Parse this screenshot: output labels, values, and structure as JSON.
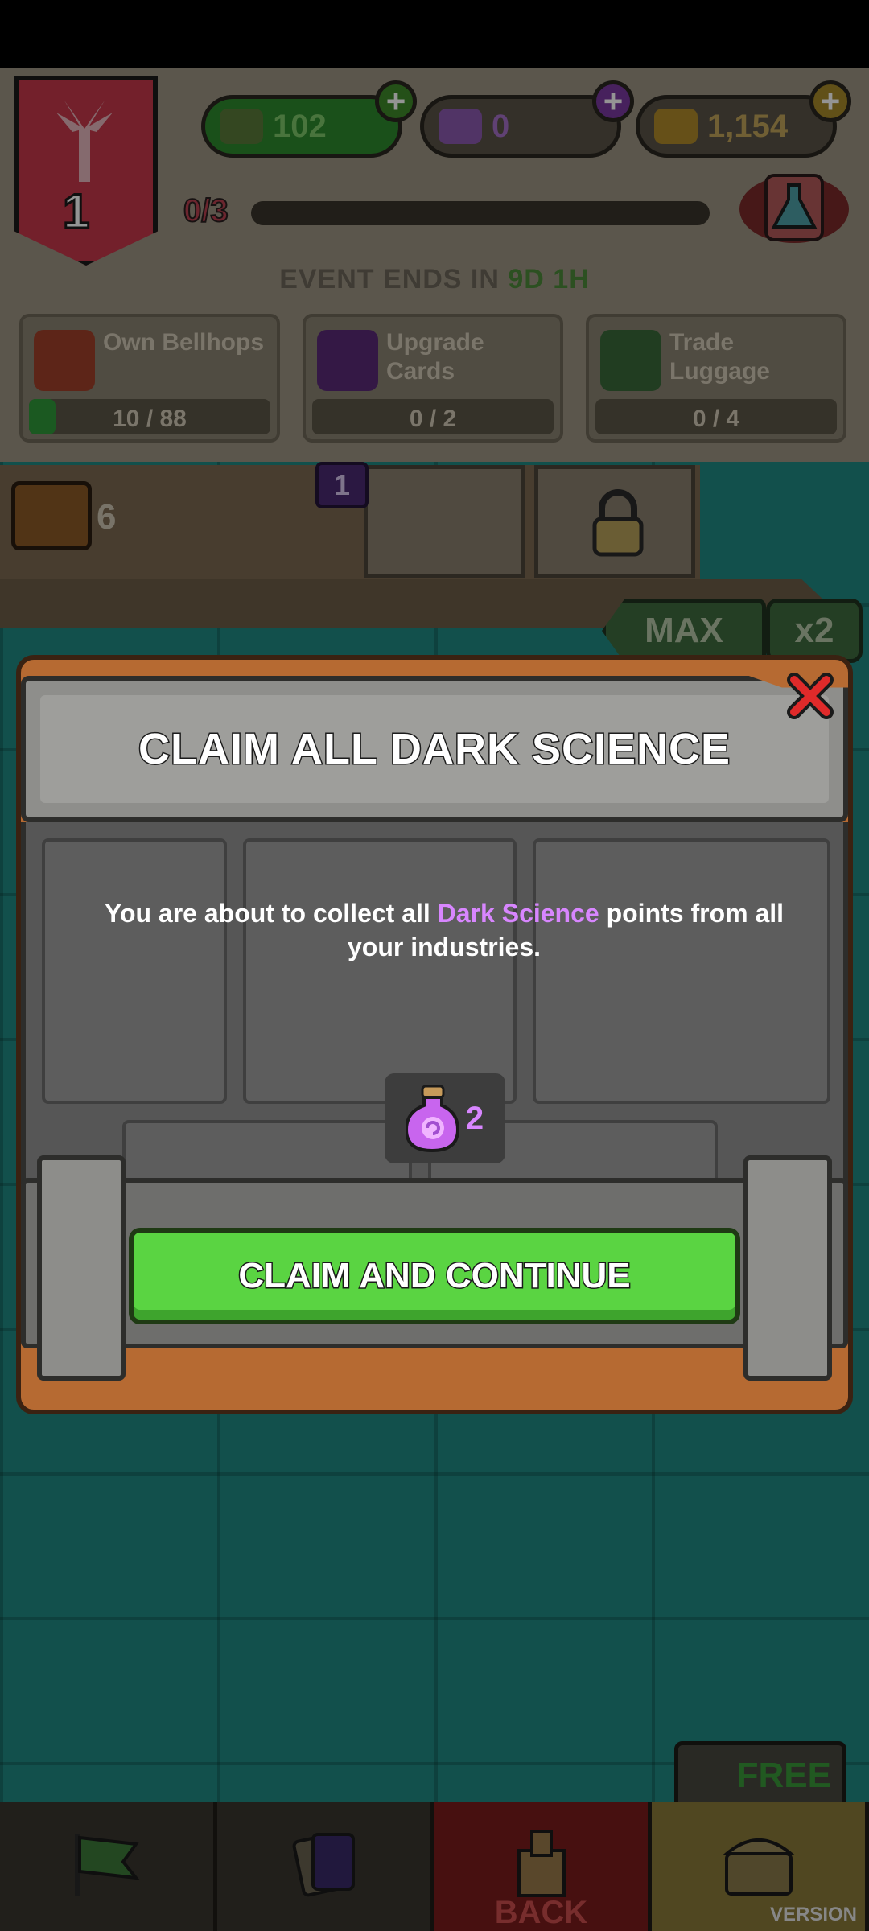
{
  "background": {
    "level": "1",
    "resources": [
      {
        "name": "cash",
        "value": "102",
        "icon": "cash-icon"
      },
      {
        "name": "dark-science",
        "value": "0",
        "icon": "potion-icon"
      },
      {
        "name": "gold",
        "value": "1,154",
        "icon": "gold-bars-icon"
      }
    ],
    "progress_text": "0/3",
    "event_prefix": "EVENT ENDS IN",
    "event_time": "9D 1H",
    "tasks": [
      {
        "label": "Own Bellhops",
        "progress": "10 / 88",
        "fraction": 0.11,
        "icon": "bellhop-hat-icon"
      },
      {
        "label": "Upgrade Cards",
        "progress": "0 / 2",
        "fraction": 0,
        "icon": "up-arrow-icon"
      },
      {
        "label": "Trade Luggage",
        "progress": "0 / 4",
        "fraction": 0,
        "icon": "trade-icon"
      }
    ],
    "luggage_count": "6",
    "slot_badge": "1",
    "max_label": "MAX",
    "x2_label": "x2",
    "free_label": "FREE",
    "nav": {
      "back_label": "BACK",
      "version_label": "VERSION"
    }
  },
  "modal": {
    "title": "CLAIM ALL DARK SCIENCE",
    "description_before": "You are about to collect all ",
    "description_highlight": "Dark Science",
    "description_after": " points from all your industries.",
    "reward": {
      "icon": "dark-science-potion-icon",
      "amount": "2"
    },
    "claim_button": "CLAIM AND CONTINUE"
  },
  "colors": {
    "highlight": "#d886ff",
    "claim_button": "#5ad442",
    "close": "#e02a2a",
    "wood": "#b66a32"
  }
}
